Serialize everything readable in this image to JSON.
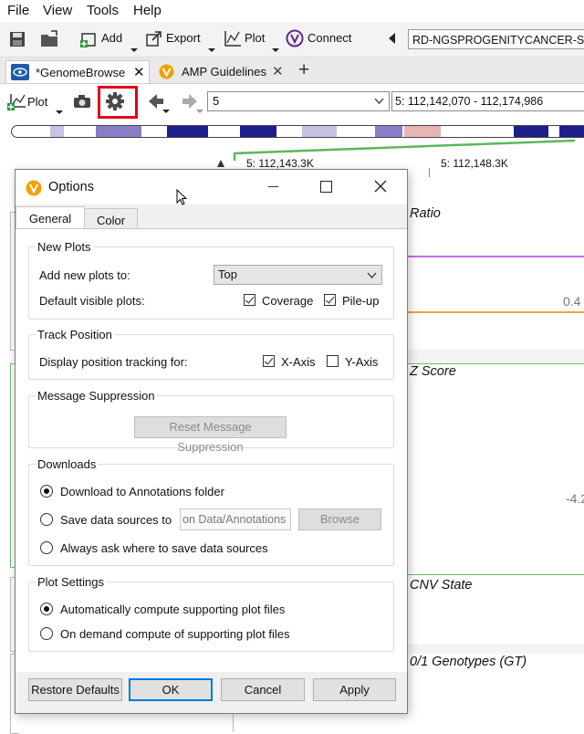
{
  "menubar": {
    "items": [
      "File",
      "View",
      "Tools",
      "Help"
    ]
  },
  "toolbar": {
    "add_label": "Add",
    "export_label": "Export",
    "plot_label": "Plot",
    "connect_label": "Connect",
    "gene_field_value": "RD-NGSPROGENITYCANCER-SAM"
  },
  "tabs": [
    {
      "label": "*GenomeBrowse"
    },
    {
      "label": "AMP Guidelines"
    }
  ],
  "browse": {
    "plot_label": "Plot",
    "chromosome_value": "5",
    "position_value": "5: 112,142,070 - 112,174,986",
    "ruler_left": "5: 112,143.3K",
    "ruler_right": "5: 112,148.3K"
  },
  "tracks": {
    "ratio_title": "Ratio",
    "ratio_value": "0.4",
    "zscore_title": "Z Score",
    "zscore_value": "-4.2",
    "cnv_title": "CNV State",
    "gt_title": "0/1 Genotypes (GT)"
  },
  "dialog": {
    "title": "Options",
    "tabs": [
      "General",
      "Color"
    ],
    "new_plots": {
      "group_label": "New Plots",
      "add_label": "Add new plots to:",
      "add_value": "Top",
      "visible_label": "Default visible plots:",
      "coverage_label": "Coverage",
      "coverage_checked": true,
      "pileup_label": "Pile-up",
      "pileup_checked": true
    },
    "track_position": {
      "group_label": "Track Position",
      "display_label": "Display position tracking for:",
      "xaxis_label": "X-Axis",
      "xaxis_checked": true,
      "yaxis_label": "Y-Axis",
      "yaxis_checked": false
    },
    "message_suppression": {
      "group_label": "Message Suppression",
      "reset_label": "Reset Message Suppression"
    },
    "downloads": {
      "group_label": "Downloads",
      "option1": "Download to Annotations folder",
      "option2": "Save data sources to",
      "option2_path": "on Data/Annotations",
      "browse_label": "Browse",
      "option3": "Always ask where to save data sources",
      "selected": 1
    },
    "plot_settings": {
      "group_label": "Plot Settings",
      "option1": "Automatically compute supporting plot files",
      "option2": "On demand compute of supporting plot files",
      "selected": 1
    },
    "buttons": {
      "restore": "Restore Defaults",
      "ok": "OK",
      "cancel": "Cancel",
      "apply": "Apply"
    }
  }
}
